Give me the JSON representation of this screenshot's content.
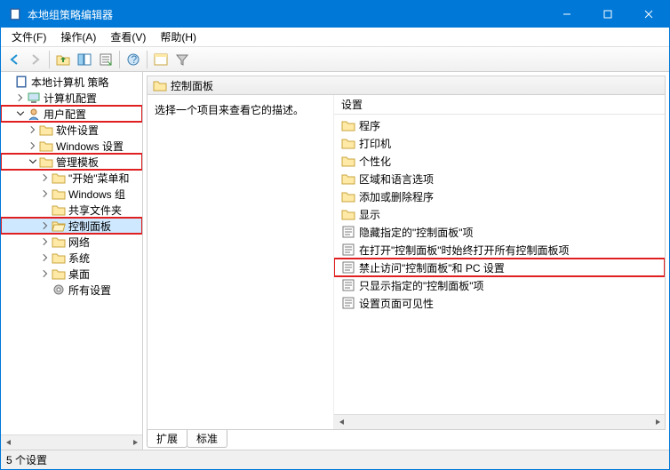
{
  "window": {
    "title": "本地组策略编辑器"
  },
  "menu": {
    "file": "文件(F)",
    "action": "操作(A)",
    "view": "查看(V)",
    "help": "帮助(H)"
  },
  "tree": {
    "root": "本地计算机 策略",
    "computer_config": "计算机配置",
    "user_config": "用户配置",
    "software_settings": "软件设置",
    "windows_settings": "Windows 设置",
    "admin_templates": "管理模板",
    "start_and": "\"开始\"菜单和",
    "windows_grp": "Windows 组",
    "shared_folders": "共享文件夹",
    "control_panel": "控制面板",
    "network": "网络",
    "system": "系统",
    "desktop": "桌面",
    "all_settings": "所有设置"
  },
  "content": {
    "header": "控制面板",
    "desc": "选择一个项目来查看它的描述。",
    "col_setting": "设置",
    "items": {
      "programs": "程序",
      "printers": "打印机",
      "personalization": "个性化",
      "region_lang": "区域和语言选项",
      "add_remove": "添加或删除程序",
      "display": "显示",
      "hide_specified": "隐藏指定的\"控制面板\"项",
      "open_always": "在打开\"控制面板\"时始终打开所有控制面板项",
      "prohibit_access": "禁止访问\"控制面板\"和 PC 设置",
      "show_only": "只显示指定的\"控制面板\"项",
      "page_visibility": "设置页面可见性"
    }
  },
  "tabs": {
    "extended": "扩展",
    "standard": "标准"
  },
  "status": "5 个设置"
}
